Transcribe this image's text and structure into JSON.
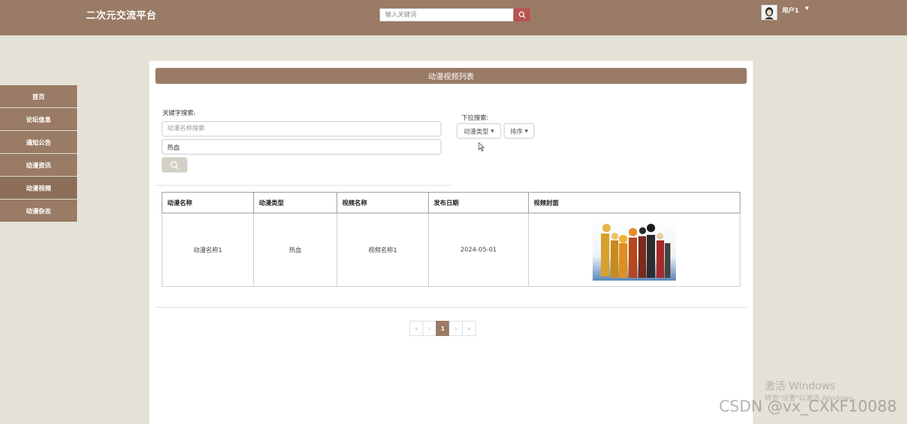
{
  "header": {
    "brand": "二次元交流平台",
    "search_placeholder": "输入关键词",
    "user_name": "用户1"
  },
  "sidebar": {
    "items": [
      {
        "label": "首页"
      },
      {
        "label": "论坛信息"
      },
      {
        "label": "通知公告"
      },
      {
        "label": "动漫资讯"
      },
      {
        "label": "动漫视频"
      },
      {
        "label": "动漫杂志"
      }
    ]
  },
  "main": {
    "title": "动漫视频列表",
    "keyword_label": "关键字搜索:",
    "keyword_placeholder": "动漫名称搜索",
    "keyword2_value": "热血",
    "dropdown_label": "下拉搜索:",
    "dropdown_type": "动漫类型",
    "dropdown_sort": "排序"
  },
  "table": {
    "headers": [
      "动漫名称",
      "动漫类型",
      "视频名称",
      "发布日期",
      "视频封面"
    ],
    "rows": [
      {
        "name": "动漫名称1",
        "type": "热血",
        "video": "视频名称1",
        "date": "2024-05-01"
      }
    ]
  },
  "pagination": {
    "first": "«",
    "prev": "‹",
    "current": "1",
    "next": "›",
    "last": "»"
  },
  "watermark": {
    "win_title": "激活 Windows",
    "win_sub": "转到\"设置\"以激活 Windows。",
    "csdn": "CSDN @vx_CXKF10088"
  },
  "colors": {
    "primary": "#9a7b65",
    "search_button": "#b85450",
    "background": "#e4e1d6"
  }
}
